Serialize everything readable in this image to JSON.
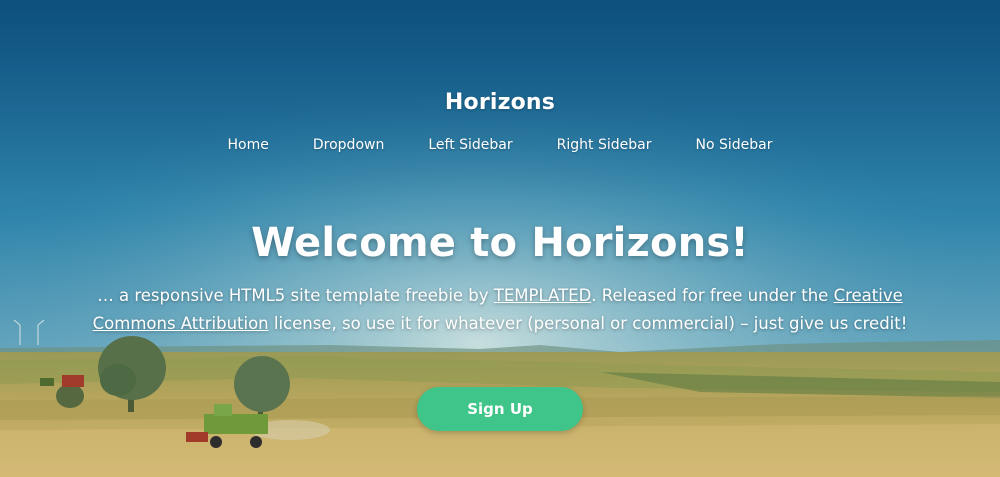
{
  "header": {
    "logo": "Horizons",
    "nav": [
      "Home",
      "Dropdown",
      "Left Sidebar",
      "Right Sidebar",
      "No Sidebar"
    ]
  },
  "banner": {
    "title": "Welcome to Horizons!",
    "desc_1": "… a responsive HTML5 site template freebie by ",
    "link_templated": "TEMPLATED",
    "desc_2": ". Released for free under the ",
    "link_license": "Creative Commons Attribution",
    "desc_3": " license, so use it for whatever (personal or commercial) – just give us credit!",
    "button": "Sign Up"
  },
  "colors": {
    "sky_top": "#15628f",
    "sky_mid": "#3f8fae",
    "field": "#bfa660",
    "accent": "#3fc589",
    "text": "#ffffff"
  }
}
